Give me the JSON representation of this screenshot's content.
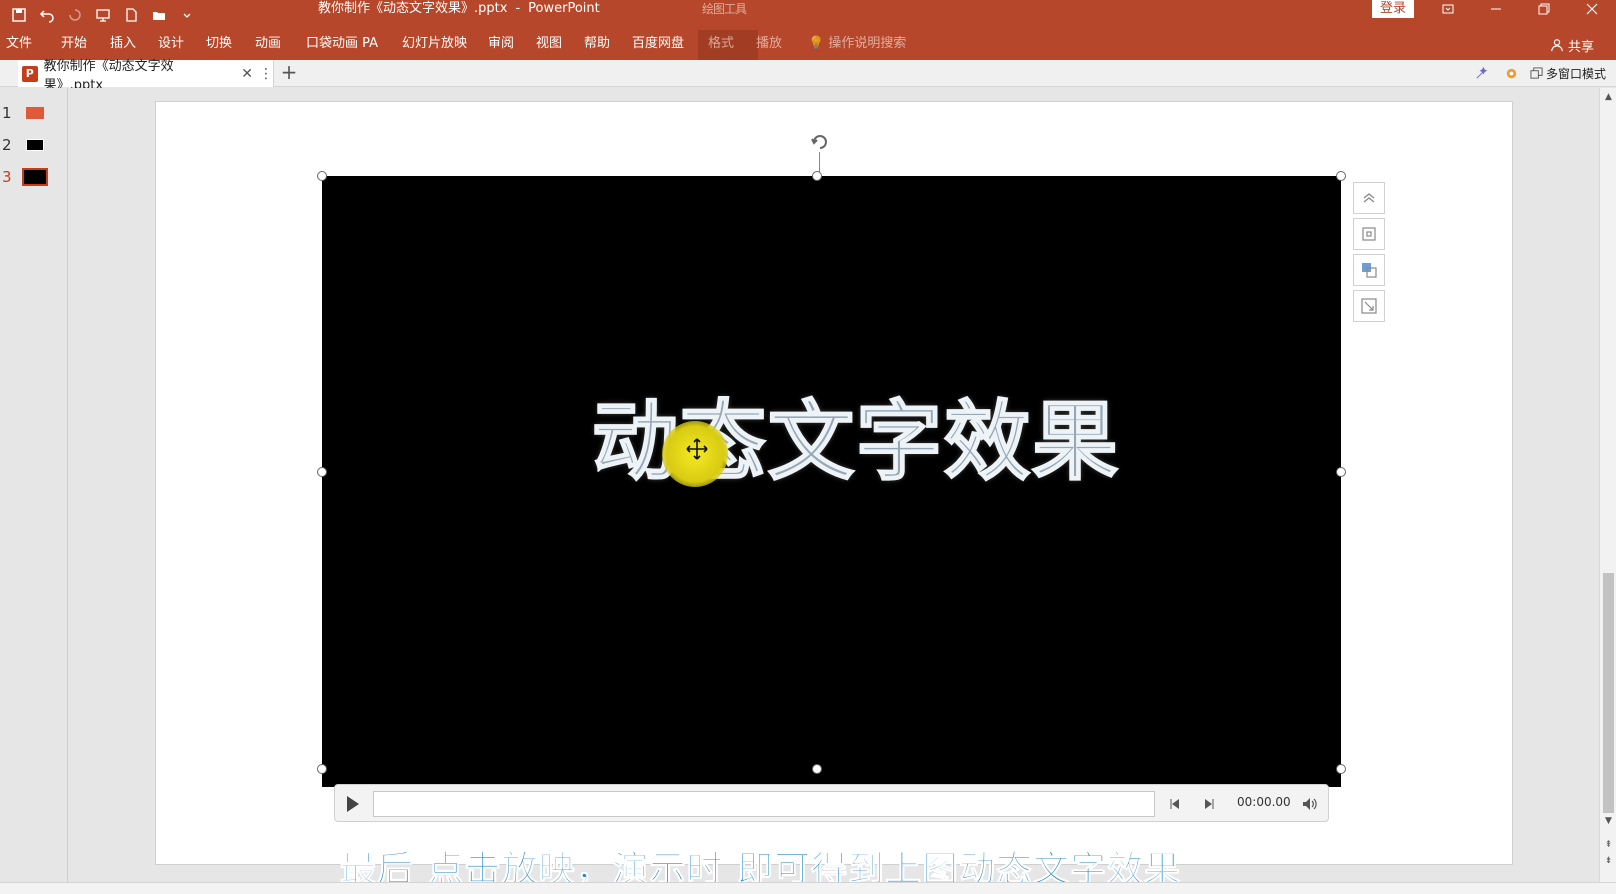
{
  "window": {
    "title": "教你制作《动态文字效果》.pptx",
    "separator": "-",
    "app": "PowerPoint",
    "context_group": "绘图工具",
    "login": "登录"
  },
  "ribbon": {
    "tabs": [
      "文件",
      "开始",
      "插入",
      "设计",
      "切换",
      "动画",
      "口袋动画 PA",
      "幻灯片放映",
      "审阅",
      "视图",
      "帮助",
      "百度网盘"
    ],
    "context_tabs": [
      "格式",
      "播放"
    ],
    "search_placeholder": "操作说明搜索",
    "share": "共享"
  },
  "doc_tab": {
    "name": "教你制作《动态文字效果》.pptx",
    "add": "+",
    "multi_window": "多窗口模式"
  },
  "slides": [
    {
      "number": "1",
      "active": false
    },
    {
      "number": "2",
      "active": false
    },
    {
      "number": "3",
      "active": true
    }
  ],
  "video": {
    "title_text": "动态文字效果"
  },
  "player": {
    "time": "00:00.00"
  },
  "caption": "最后 点击放映，演示时 即可得到上图动态文字效果",
  "colors": {
    "accent": "#b7472a",
    "caption": "#1b86c9"
  }
}
